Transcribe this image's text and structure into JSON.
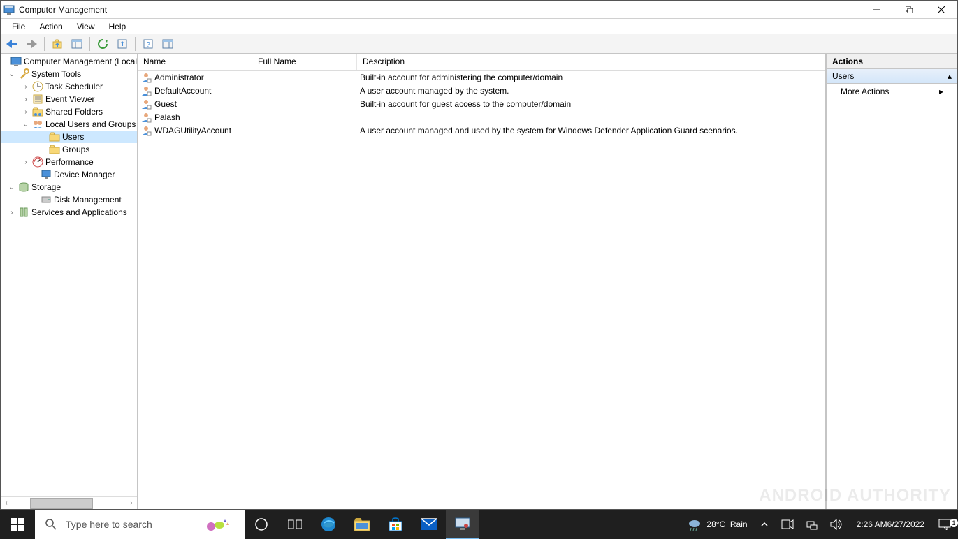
{
  "window": {
    "title": "Computer Management"
  },
  "menu": [
    "File",
    "Action",
    "View",
    "Help"
  ],
  "tree": {
    "root": "Computer Management (Local",
    "system_tools": "System Tools",
    "task_scheduler": "Task Scheduler",
    "event_viewer": "Event Viewer",
    "shared_folders": "Shared Folders",
    "local_users": "Local Users and Groups",
    "users": "Users",
    "groups": "Groups",
    "performance": "Performance",
    "device_manager": "Device Manager",
    "storage": "Storage",
    "disk_management": "Disk Management",
    "services_apps": "Services and Applications"
  },
  "list": {
    "headers": {
      "name": "Name",
      "fullname": "Full Name",
      "description": "Description"
    },
    "rows": [
      {
        "name": "Administrator",
        "fullname": "",
        "description": "Built-in account for administering the computer/domain"
      },
      {
        "name": "DefaultAccount",
        "fullname": "",
        "description": "A user account managed by the system."
      },
      {
        "name": "Guest",
        "fullname": "",
        "description": "Built-in account for guest access to the computer/domain"
      },
      {
        "name": "Palash",
        "fullname": "",
        "description": ""
      },
      {
        "name": "WDAGUtilityAccount",
        "fullname": "",
        "description": "A user account managed and used by the system for Windows Defender Application Guard scenarios."
      }
    ]
  },
  "actions": {
    "title": "Actions",
    "section": "Users",
    "more": "More Actions"
  },
  "taskbar": {
    "search_placeholder": "Type here to search",
    "weather_temp": "28°C",
    "weather_cond": "Rain",
    "time": "2:26 AM",
    "date": "6/27/2022"
  },
  "watermark": "ANDROID AUTHORITY"
}
